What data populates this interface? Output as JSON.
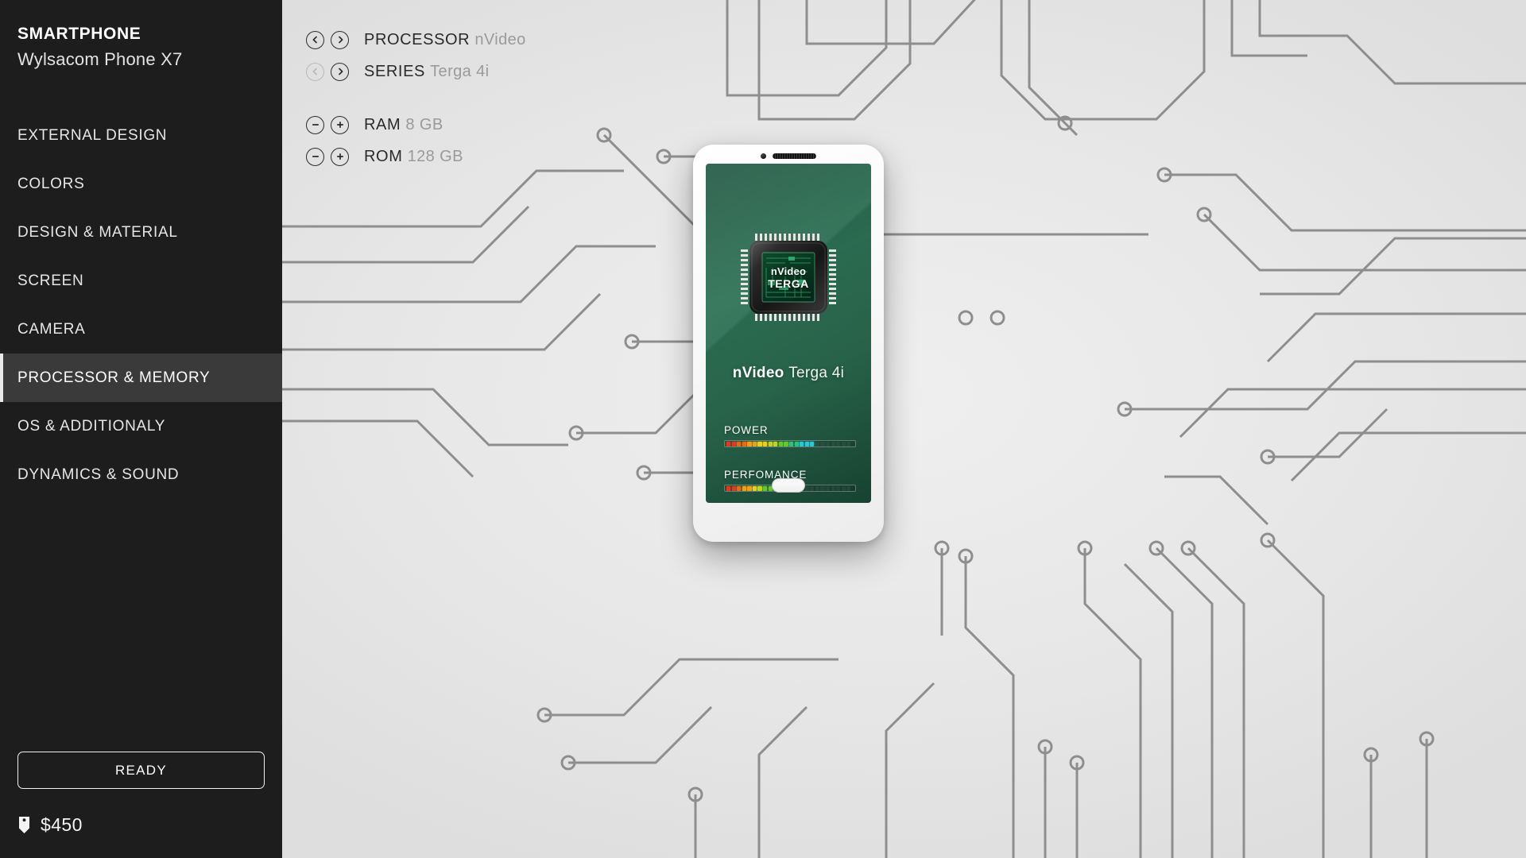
{
  "sidebar": {
    "brand_title": "SMARTPHONE",
    "brand_subtitle": "Wylsacom Phone X7",
    "menu": [
      {
        "label": "EXTERNAL DESIGN",
        "active": false
      },
      {
        "label": "COLORS",
        "active": false
      },
      {
        "label": "DESIGN & MATERIAL",
        "active": false
      },
      {
        "label": "SCREEN",
        "active": false
      },
      {
        "label": "CAMERA",
        "active": false
      },
      {
        "label": "PROCESSOR & MEMORY",
        "active": true
      },
      {
        "label": "OS & ADDITIONALY",
        "active": false
      },
      {
        "label": "DYNAMICS & SOUND",
        "active": false
      }
    ],
    "ready_button": "READY",
    "price": "$450",
    "price_icon": "price-tag-icon"
  },
  "options": [
    {
      "type": "stepper-arrows",
      "label": "PROCESSOR",
      "value": "nVideo",
      "prev_icon": "chevron-left-icon",
      "next_icon": "chevron-right-icon",
      "prev_enabled": true,
      "next_enabled": true
    },
    {
      "type": "stepper-arrows",
      "label": "SERIES",
      "value": "Terga 4i",
      "prev_icon": "chevron-left-icon",
      "next_icon": "chevron-right-icon",
      "prev_enabled": false,
      "next_enabled": true
    },
    {
      "type": "stepper-plusminus",
      "label": "RAM",
      "value": "8 GB",
      "minus_icon": "minus-circle-icon",
      "plus_icon": "plus-circle-icon",
      "minus_enabled": true,
      "plus_enabled": true
    },
    {
      "type": "stepper-plusminus",
      "label": "ROM",
      "value": "128 GB",
      "minus_icon": "minus-circle-icon",
      "plus_icon": "plus-circle-icon",
      "minus_enabled": true,
      "plus_enabled": true
    }
  ],
  "phone_preview": {
    "chip_die_line1": "nVideo",
    "chip_die_line2": "TERGA",
    "chip_name_brand": "nVideo",
    "chip_name_model": "Terga 4i",
    "meters": [
      {
        "label": "POWER",
        "filled": 17,
        "total": 24
      },
      {
        "label": "PERFOMANCE",
        "filled": 13,
        "total": 24
      }
    ]
  },
  "colors": {
    "sidebar_bg": "#1d1d1d",
    "sidebar_active_bg": "#3a3a3a",
    "main_bg": "#e8e8e8",
    "trace": "#8e8e8e",
    "screen_green_dark": "#1a4b38",
    "screen_green_light": "#2e7256",
    "text_dark": "#2a2a2a",
    "text_muted": "#9a9a9a"
  }
}
